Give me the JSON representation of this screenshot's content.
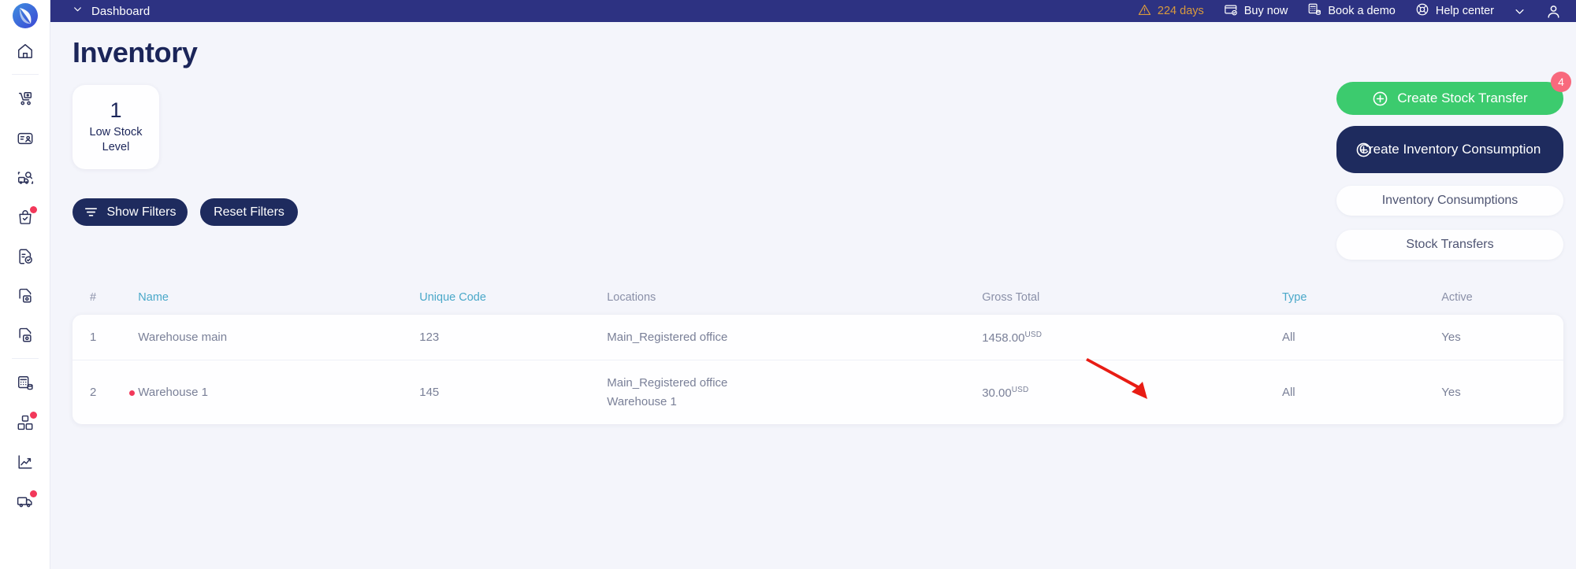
{
  "topbar": {
    "menu_icon": "chevron-down-icon",
    "title": "Dashboard",
    "trial": {
      "icon": "warning-triangle-icon",
      "label": "224 days"
    },
    "buy_now": {
      "icon": "credit-card-check-icon",
      "label": "Buy now"
    },
    "book_demo": {
      "icon": "calculator-database-icon",
      "label": "Book a demo"
    },
    "help_center": {
      "icon": "lifebuoy-icon",
      "label": "Help center"
    },
    "account_chevron": "chevron-down-icon",
    "account_avatar": "user-avatar-icon",
    "bg_color": "#2d3282",
    "trial_color": "#d99a3d"
  },
  "sidebar": {
    "logo": "app-logo-icon",
    "items": [
      {
        "icon": "home-icon",
        "name": "home",
        "badge": false
      },
      {
        "icon": "delivery-trolley-icon",
        "name": "shipments",
        "badge": false
      },
      {
        "icon": "contact-card-icon",
        "name": "contacts",
        "badge": false
      },
      {
        "icon": "truck-search-icon",
        "name": "tracking",
        "badge": false
      },
      {
        "icon": "bag-check-icon",
        "name": "orders",
        "badge": true
      },
      {
        "icon": "document-check-icon",
        "name": "documents",
        "badge": false
      },
      {
        "icon": "file-image-icon",
        "name": "files-1",
        "badge": false
      },
      {
        "icon": "file-image-icon",
        "name": "files-2",
        "badge": false
      },
      {
        "icon": "calculator-database-icon",
        "name": "accounting",
        "badge": false
      },
      {
        "icon": "boxes-icon",
        "name": "inventory",
        "badge": true
      },
      {
        "icon": "chart-line-up-icon",
        "name": "reports",
        "badge": false
      },
      {
        "icon": "truck-icon",
        "name": "fleet",
        "badge": true
      }
    ]
  },
  "page": {
    "title": "Inventory"
  },
  "stat_card": {
    "value": "1",
    "label": "Low Stock Level"
  },
  "filters": {
    "show_icon": "filter-icon",
    "show_label": "Show Filters",
    "reset_label": "Reset Filters"
  },
  "actions": {
    "stock_transfer": {
      "icon": "plus-circle-icon",
      "label": "Create Stock Transfer",
      "badge": "4",
      "color": "#3ccb6e",
      "badge_color": "#f8697d"
    },
    "create_consumption": {
      "icon": "plus-circle-icon",
      "label": "Create Inventory Consumption",
      "color": "#1e2b5e"
    },
    "inventory_consumptions": {
      "label": "Inventory Consumptions"
    },
    "stock_transfers": {
      "label": "Stock Transfers"
    }
  },
  "table": {
    "columns": [
      {
        "key": "num",
        "label": "#",
        "sortable": false
      },
      {
        "key": "name",
        "label": "Name",
        "sortable": true
      },
      {
        "key": "code",
        "label": "Unique Code",
        "sortable": true
      },
      {
        "key": "loc",
        "label": "Locations",
        "sortable": false
      },
      {
        "key": "gross",
        "label": "Gross Total",
        "sortable": false
      },
      {
        "key": "type",
        "label": "Type",
        "sortable": true
      },
      {
        "key": "active",
        "label": "Active",
        "sortable": false
      }
    ],
    "sortable_color": "#4aa8c9",
    "rows": [
      {
        "num": "1",
        "dot": false,
        "name": "Warehouse main",
        "code": "123",
        "locations": [
          "Main_Registered office"
        ],
        "gross_amount": "1458.00",
        "gross_currency": "USD",
        "type": "All",
        "active": "Yes"
      },
      {
        "num": "2",
        "dot": true,
        "name": "Warehouse 1",
        "code": "145",
        "locations": [
          "Main_Registered office",
          "Warehouse 1"
        ],
        "gross_amount": "30.00",
        "gross_currency": "USD",
        "type": "All",
        "active": "Yes"
      }
    ]
  },
  "annotation": {
    "arrow": "red-arrow-pointing-to-gross-total",
    "color": "#e81c14"
  }
}
